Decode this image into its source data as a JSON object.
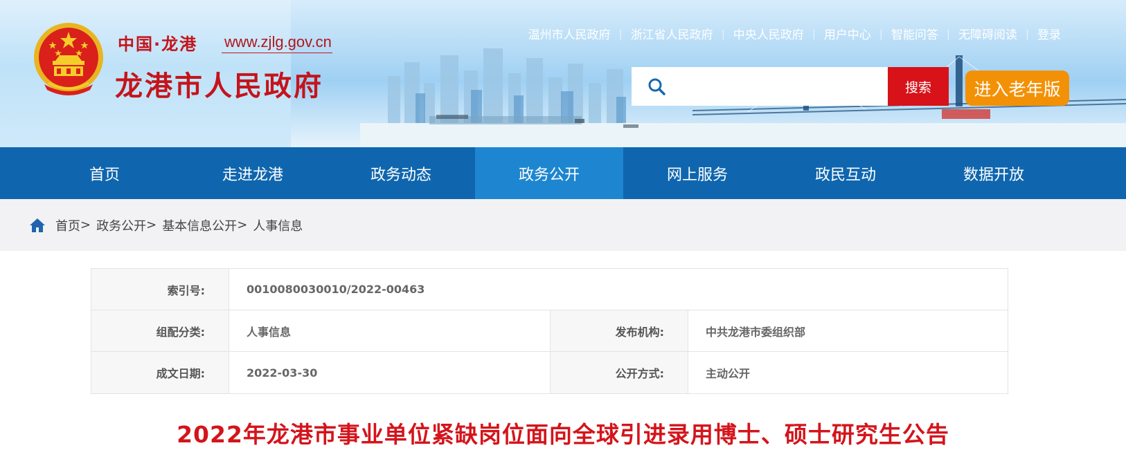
{
  "header": {
    "site_cn": "中国·龙港",
    "site_url": "www.zjlg.gov.cn",
    "site_title": "龙港市人民政府",
    "emblem_icon": "national-emblem-icon",
    "top_links": [
      "温州市人民政府",
      "浙江省人民政府",
      "中央人民政府",
      "用户中心",
      "智能问答",
      "无障碍阅读",
      "登录"
    ],
    "search": {
      "placeholder": "",
      "button_label": "搜索"
    },
    "elder_button": "进入老年版"
  },
  "nav": {
    "items": [
      "首页",
      "走进龙港",
      "政务动态",
      "政务公开",
      "网上服务",
      "政民互动",
      "数据开放"
    ],
    "active": "政务公开"
  },
  "breadcrumb": {
    "icon": "home-icon",
    "items": [
      "首页",
      "政务公开",
      "基本信息公开",
      "人事信息"
    ],
    "separator": ">"
  },
  "info": {
    "index_label": "索引号:",
    "index_value": "0010080030010/2022-00463",
    "category_label": "组配分类:",
    "category_value": "人事信息",
    "publisher_label": "发布机构:",
    "publisher_value": "中共龙港市委组织部",
    "date_label": "成文日期:",
    "date_value": "2022-03-30",
    "mode_label": "公开方式:",
    "mode_value": "主动公开"
  },
  "article": {
    "title": "2022年龙港市事业单位紧缺岗位面向全球引进录用博士、硕士研究生公告"
  },
  "colors": {
    "brand_red": "#c4141b",
    "nav_blue": "#0f66ae",
    "nav_active": "#1e86d0",
    "search_red": "#d71219",
    "elder_orange": "#f39106"
  }
}
